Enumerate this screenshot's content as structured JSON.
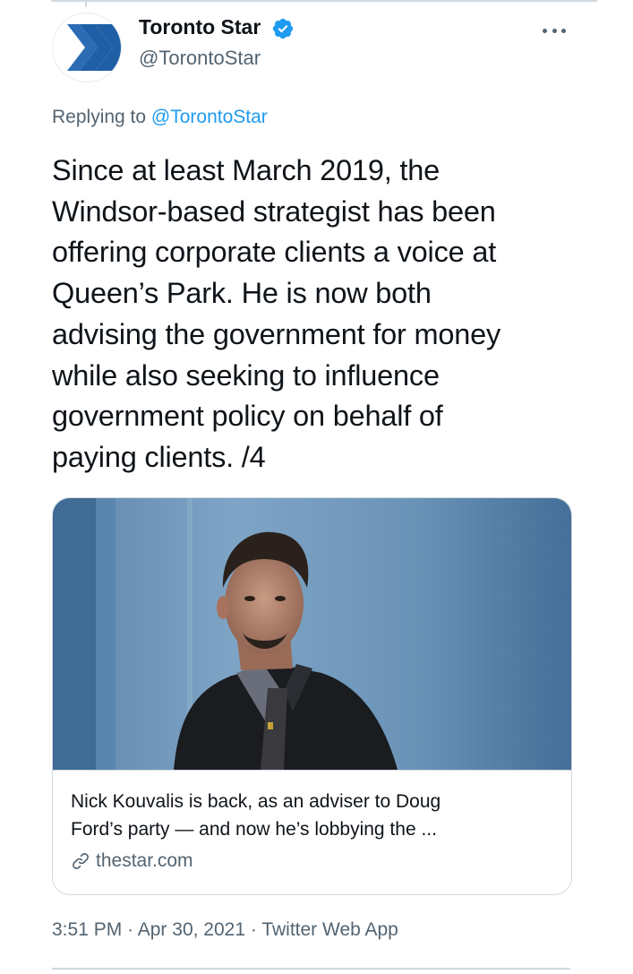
{
  "author": {
    "display_name": "Toronto Star",
    "handle": "@TorontoStar",
    "verified": true
  },
  "reply": {
    "prefix": "Replying to",
    "mention": "@TorontoStar"
  },
  "tweet": {
    "lines": [
      "Since at least March 2019, the",
      "Windsor-based strategist has been",
      "offering corporate clients a voice at",
      "Queen’s Park. He is now both",
      "advising the government for money",
      "while also seeking to influence",
      "government policy on behalf of",
      "paying clients. /4"
    ]
  },
  "card": {
    "title_lines": [
      "Nick Kouvalis is back, as an adviser to Doug",
      "Ford’s party — and now he’s lobbying the ..."
    ],
    "domain": "thestar.com"
  },
  "meta": {
    "time": "3:51 PM",
    "separator": "·",
    "date": "Apr 30, 2021",
    "source": "Twitter Web App"
  },
  "colors": {
    "accent": "#1d9bf0",
    "secondary_text": "#536471",
    "brand_blue": "#1f5fa6",
    "border": "#cfd9de"
  },
  "icons": {
    "avatar_logo": "toronto-star-chevron",
    "verified": "verified-badge-icon",
    "more": "more-options-icon",
    "link": "link-icon"
  }
}
